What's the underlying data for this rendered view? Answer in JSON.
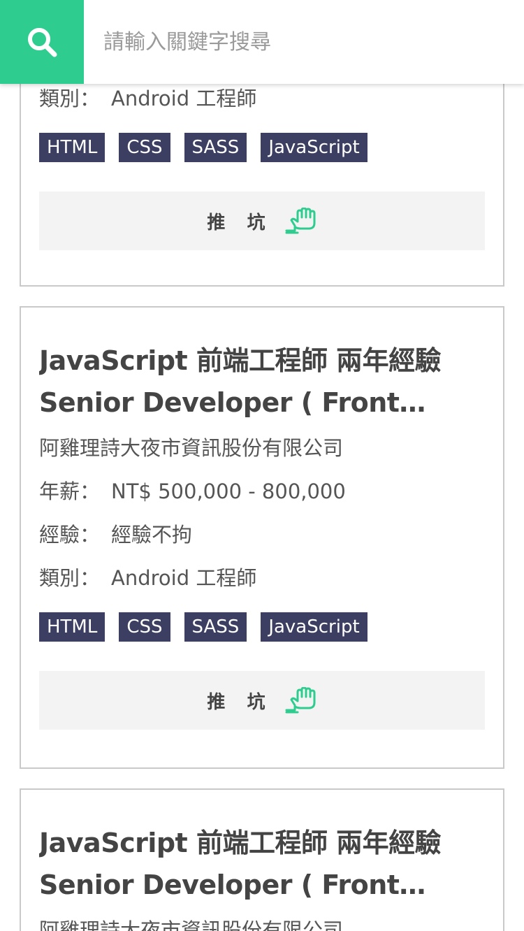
{
  "search": {
    "placeholder": "請輸入關鍵字搜尋"
  },
  "colors": {
    "accent": "#2ecc8f",
    "tag_bg": "#3c3f61"
  },
  "labels": {
    "salary": "年薪：",
    "experience": "經驗：",
    "category": "類別：",
    "apply": "推 坑"
  },
  "jobs": [
    {
      "category": "Android 工程師",
      "tags": [
        "HTML",
        "CSS",
        "SASS",
        "JavaScript"
      ]
    },
    {
      "title_line1": "JavaScript 前端工程師 兩年經驗",
      "title_line2": "Senior Developer ( Front…",
      "company": "阿雞理詩大夜市資訊股份有限公司",
      "salary": "NT$ 500,000 - 800,000",
      "experience": "經驗不拘",
      "category": "Android 工程師",
      "tags": [
        "HTML",
        "CSS",
        "SASS",
        "JavaScript"
      ]
    },
    {
      "title_line1": "JavaScript 前端工程師 兩年經驗",
      "title_line2": "Senior Developer ( Front…",
      "company": "阿雞理詩大夜市資訊股份有限公司"
    }
  ]
}
